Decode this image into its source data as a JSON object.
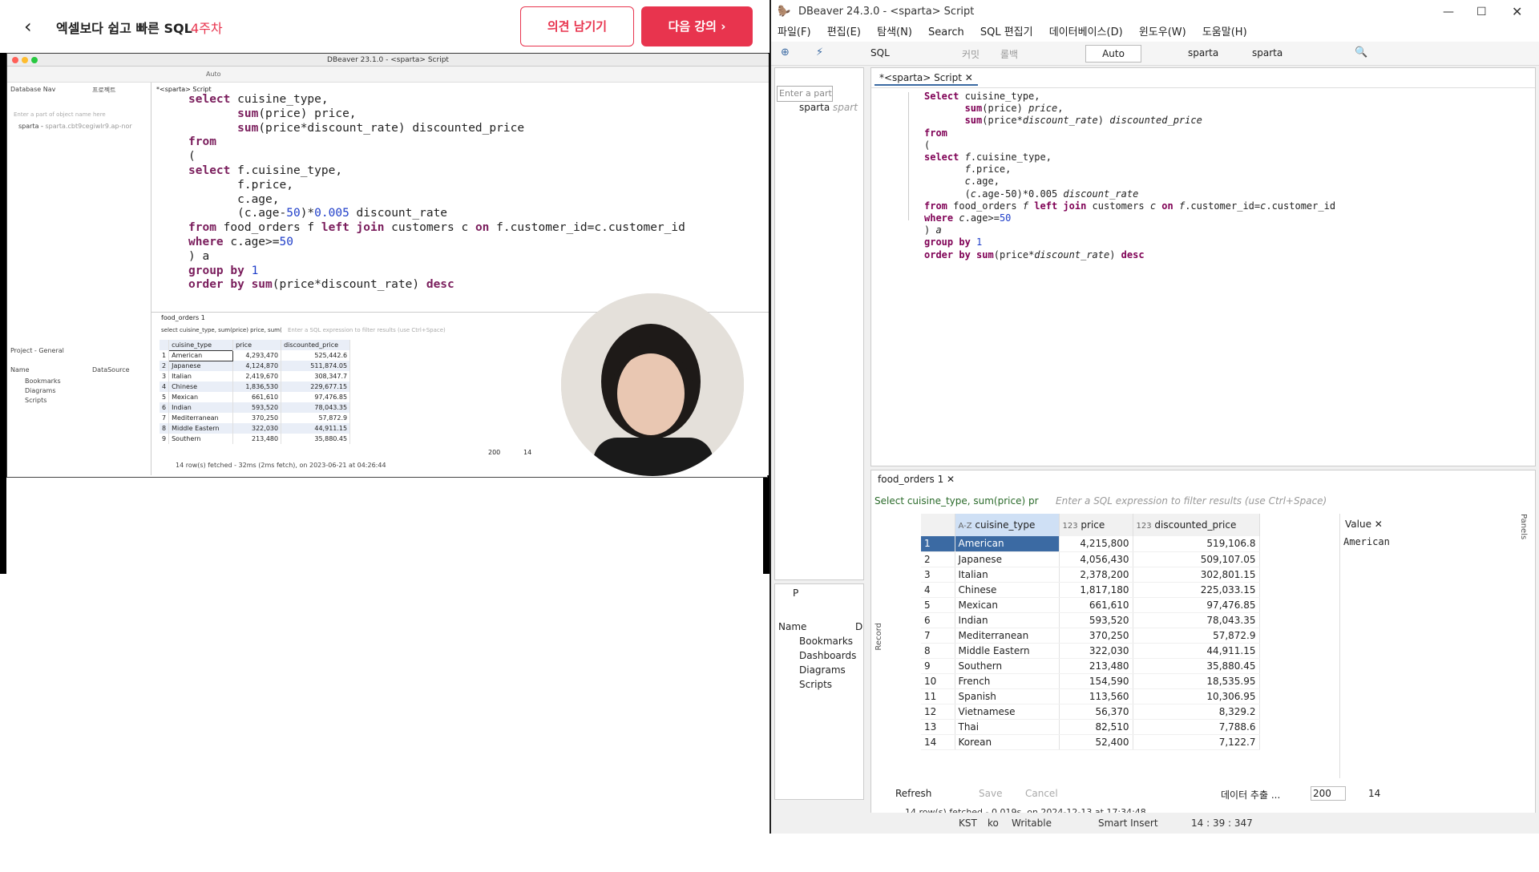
{
  "course": {
    "title": "엑셀보다 쉽고 빠른 SQL",
    "week": "4주차",
    "feedback_button": "의견 남기기",
    "next_button": "다음 강의",
    "next_icon": "›",
    "back_icon": "‹"
  },
  "video": {
    "window_title": "DBeaver 23.1.0 - <sparta> Script",
    "tab_db_nav": "Database Nav",
    "tab_project": "프로젝트",
    "tab_script": "*<sparta> Script",
    "filter_placeholder": "Enter a part of object name here",
    "connection": "sparta",
    "connection_host": "sparta.cbt9cegiwlr9.ap-nor",
    "project_panel": "Project - General",
    "project_cols": [
      "Name",
      "DataSource"
    ],
    "project_items": [
      "Bookmarks",
      "Diagrams",
      "Scripts"
    ],
    "result_tab": "food_orders 1",
    "result_query": "select cuisine_type, sum(price) price, sum(",
    "result_filter_placeholder": "Enter a SQL expression to filter results (use Ctrl+Space)",
    "result_columns": [
      "cuisine_type",
      "price",
      "discounted_price"
    ],
    "rows": [
      [
        "1",
        "American",
        "4,293,470",
        "525,442.6"
      ],
      [
        "2",
        "Japanese",
        "4,124,870",
        "511,874.05"
      ],
      [
        "3",
        "Italian",
        "2,419,670",
        "308,347.7"
      ],
      [
        "4",
        "Chinese",
        "1,836,530",
        "229,677.15"
      ],
      [
        "5",
        "Mexican",
        "661,610",
        "97,476.85"
      ],
      [
        "6",
        "Indian",
        "593,520",
        "78,043.35"
      ],
      [
        "7",
        "Mediterranean",
        "370,250",
        "57,872.9"
      ],
      [
        "8",
        "Middle Eastern",
        "322,030",
        "44,911.15"
      ],
      [
        "9",
        "Southern",
        "213,480",
        "35,880.45"
      ]
    ],
    "status": "14 row(s) fetched - 32ms (2ms fetch), on 2023-06-21 at 04:26:44",
    "fetch_size": "200",
    "row_count": "14",
    "auto": "Auto"
  },
  "app": {
    "window_title": "DBeaver 24.3.0 - <sparta> Script",
    "menu": [
      "파일(F)",
      "편집(E)",
      "탐색(N)",
      "Search",
      "SQL 편집기",
      "데이터베이스(D)",
      "윈도우(W)",
      "도움말(H)"
    ],
    "toolbar": {
      "sql_label": "SQL",
      "commit_label": "커밋",
      "rollback_label": "롤백",
      "auto_label": "Auto",
      "datasource": "sparta",
      "schema": "sparta"
    },
    "nav_filter_placeholder": "Enter a part",
    "nav_connection": "sparta",
    "nav_connection_detail": "spart",
    "editor_tab": "*<sparta> Script",
    "project_tab": "P",
    "project_col": "Name",
    "project_col2": "D",
    "project_items": [
      "Bookmarks",
      "Dashboards",
      "Diagrams",
      "Scripts"
    ],
    "result_tab": "food_orders 1",
    "result_query": "Select cuisine_type, sum(price) pr",
    "result_filter_placeholder": "Enter a SQL expression to filter results (use Ctrl+Space)",
    "columns": [
      "cuisine_type",
      "price",
      "discounted_price"
    ],
    "column_types": [
      "A-Z",
      "123",
      "123"
    ],
    "rows": [
      [
        "1",
        "American",
        "4,215,800",
        "519,106.8"
      ],
      [
        "2",
        "Japanese",
        "4,056,430",
        "509,107.05"
      ],
      [
        "3",
        "Italian",
        "2,378,200",
        "302,801.15"
      ],
      [
        "4",
        "Chinese",
        "1,817,180",
        "225,033.15"
      ],
      [
        "5",
        "Mexican",
        "661,610",
        "97,476.85"
      ],
      [
        "6",
        "Indian",
        "593,520",
        "78,043.35"
      ],
      [
        "7",
        "Mediterranean",
        "370,250",
        "57,872.9"
      ],
      [
        "8",
        "Middle Eastern",
        "322,030",
        "44,911.15"
      ],
      [
        "9",
        "Southern",
        "213,480",
        "35,880.45"
      ],
      [
        "10",
        "French",
        "154,590",
        "18,535.95"
      ],
      [
        "11",
        "Spanish",
        "113,560",
        "10,306.95"
      ],
      [
        "12",
        "Vietnamese",
        "56,370",
        "8,329.2"
      ],
      [
        "13",
        "Thai",
        "82,510",
        "7,788.6"
      ],
      [
        "14",
        "Korean",
        "52,400",
        "7,122.7"
      ]
    ],
    "value_panel_title": "Value",
    "value_panel_value": "American",
    "bottom_toolbar": {
      "refresh": "Refresh",
      "save": "Save",
      "cancel": "Cancel",
      "export": "데이터 추출 ...",
      "fetch_size": "200",
      "row_count": "14"
    },
    "fetch_status": "14 row(s) fetched - 0.019s, on 2024-12-13 at 17:34:48",
    "status_tz": "KST",
    "status_lang": "ko",
    "status_mode": "Writable",
    "status_insert": "Smart Insert",
    "status_pos": "14 : 39 : 347",
    "side_tabs": [
      "Record",
      "Panels"
    ]
  }
}
